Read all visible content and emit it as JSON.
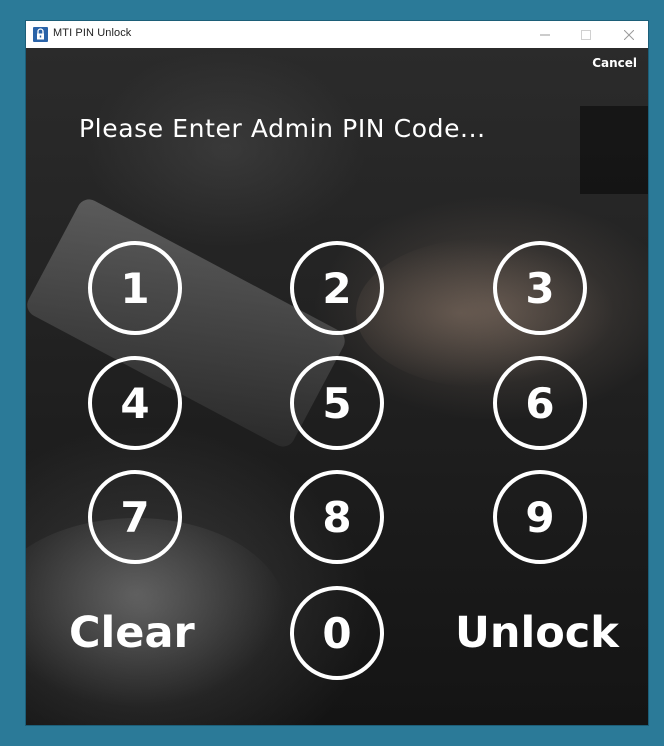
{
  "window": {
    "title": "MTI PIN Unlock",
    "icon": "lock-app-icon"
  },
  "header": {
    "cancel_label": "Cancel"
  },
  "prompt": "Please Enter Admin PIN Code...",
  "keypad": {
    "keys": [
      "1",
      "2",
      "3",
      "4",
      "5",
      "6",
      "7",
      "8",
      "9",
      "0"
    ]
  },
  "actions": {
    "clear_label": "Clear",
    "unlock_label": "Unlock"
  },
  "colors": {
    "desktop_bg": "#2b7a98",
    "text": "#ffffff",
    "app_icon": "#2a63a8"
  }
}
